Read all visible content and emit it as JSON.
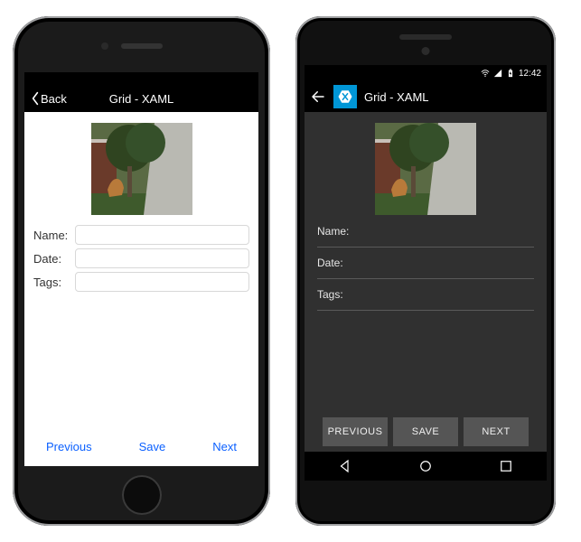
{
  "ios": {
    "nav": {
      "back": "Back",
      "title": "Grid - XAML"
    },
    "form": {
      "name_label": "Name:",
      "date_label": "Date:",
      "tags_label": "Tags:",
      "name_value": "",
      "date_value": "",
      "tags_value": ""
    },
    "footer": {
      "previous": "Previous",
      "save": "Save",
      "next": "Next"
    }
  },
  "android": {
    "status": {
      "time": "12:42"
    },
    "nav": {
      "title": "Grid - XAML"
    },
    "form": {
      "name_label": "Name:",
      "date_label": "Date:",
      "tags_label": "Tags:",
      "name_value": "",
      "date_value": "",
      "tags_value": ""
    },
    "footer": {
      "previous": "PREVIOUS",
      "save": "SAVE",
      "next": "NEXT"
    }
  }
}
